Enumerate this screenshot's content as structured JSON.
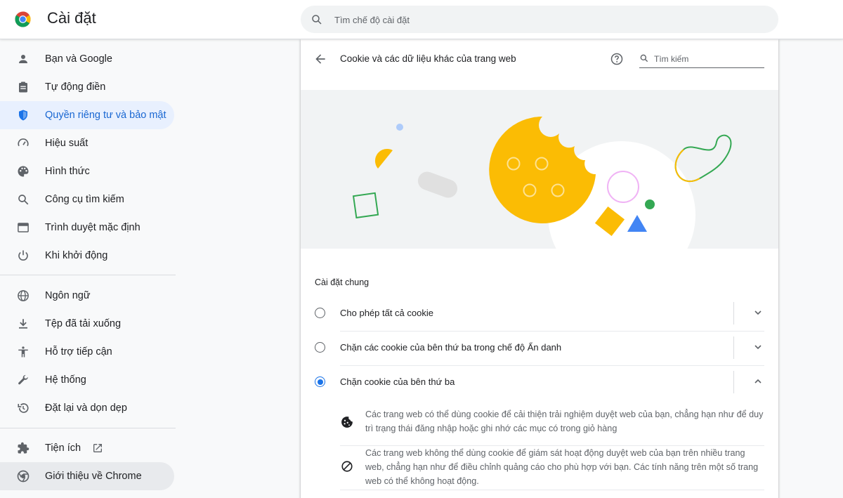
{
  "header": {
    "title": "Cài đặt",
    "search_placeholder": "Tìm chế độ cài đặt"
  },
  "sidebar": {
    "items": [
      {
        "label": "Bạn và Google",
        "icon": "person-icon"
      },
      {
        "label": "Tự động điền",
        "icon": "clipboard-icon"
      },
      {
        "label": "Quyền riêng tư và bảo mật",
        "icon": "shield-icon",
        "active": true
      },
      {
        "label": "Hiệu suất",
        "icon": "speedometer-icon"
      },
      {
        "label": "Hình thức",
        "icon": "palette-icon"
      },
      {
        "label": "Công cụ tìm kiếm",
        "icon": "search-icon"
      },
      {
        "label": "Trình duyệt mặc định",
        "icon": "browser-window-icon"
      },
      {
        "label": "Khi khởi động",
        "icon": "power-icon"
      },
      {
        "label": "Ngôn ngữ",
        "icon": "globe-icon"
      },
      {
        "label": "Tệp đã tải xuống",
        "icon": "download-icon"
      },
      {
        "label": "Hỗ trợ tiếp cận",
        "icon": "accessibility-icon"
      },
      {
        "label": "Hệ thống",
        "icon": "wrench-icon"
      },
      {
        "label": "Đặt lại và dọn dẹp",
        "icon": "restore-icon"
      },
      {
        "label": "Tiện ích",
        "icon": "puzzle-icon"
      },
      {
        "label": "Giới thiệu về Chrome",
        "icon": "chrome-icon"
      }
    ]
  },
  "main": {
    "title": "Cookie và các dữ liệu khác của trang web",
    "search_placeholder": "Tìm kiếm",
    "section_label": "Cài đặt chung",
    "options": [
      {
        "label": "Cho phép tất cả cookie",
        "checked": false,
        "expanded": false
      },
      {
        "label": "Chặn các cookie của bên thứ ba trong chế độ Ẩn danh",
        "checked": false,
        "expanded": false
      },
      {
        "label": "Chặn cookie của bên thứ ba",
        "checked": true,
        "expanded": true
      }
    ],
    "details": [
      {
        "icon": "cookie-icon",
        "text": "Các trang web có thể dùng cookie để cải thiện trải nghiệm duyệt web của bạn, chẳng hạn như để duy trì trạng thái đăng nhập hoặc ghi nhớ các mục có trong giỏ hàng"
      },
      {
        "icon": "block-icon",
        "text": "Các trang web không thể dùng cookie để giám sát hoạt động duyệt web của bạn trên nhiều trang web, chẳng hạn như để điều chỉnh quảng cáo cho phù hợp với bạn. Các tính năng trên một số trang web có thể không hoạt động."
      }
    ]
  },
  "colors": {
    "accent": "#1a73e8",
    "active_bg": "#e8f0fe",
    "cookie_yellow": "#fbbc04",
    "green": "#34a853"
  }
}
